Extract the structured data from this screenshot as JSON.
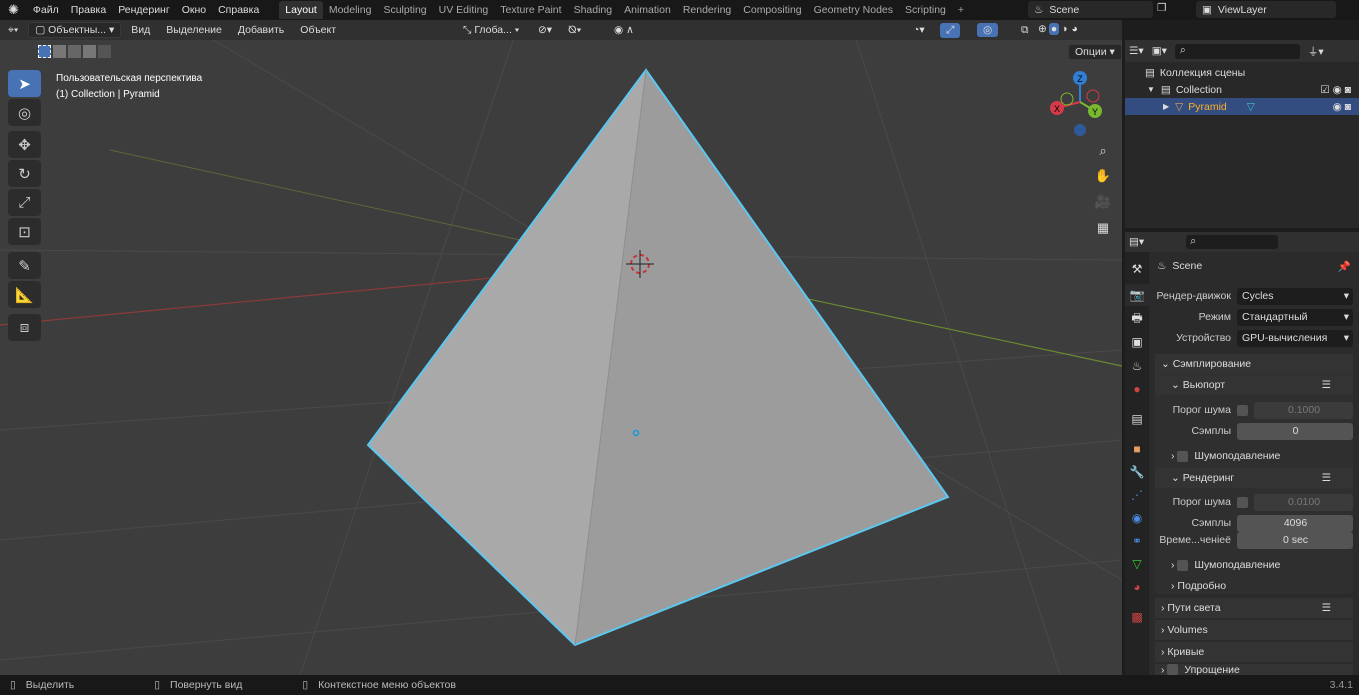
{
  "menu": {
    "items": [
      "Файл",
      "Правка",
      "Рендеринг",
      "Окно",
      "Справка"
    ]
  },
  "workspaces": [
    "Layout",
    "Modeling",
    "Sculpting",
    "UV Editing",
    "Texture Paint",
    "Shading",
    "Animation",
    "Rendering",
    "Compositing",
    "Geometry Nodes",
    "Scripting",
    "+"
  ],
  "scene": "Scene",
  "view_layer": "ViewLayer",
  "viewport": {
    "mode": "Объектны...",
    "menus": [
      "Вид",
      "Выделение",
      "Добавить",
      "Объект"
    ],
    "orientation": "Глоба...",
    "options": "Опции",
    "info_line1": "Пользовательская перспектива",
    "info_line2": "(1) Collection | Pyramid"
  },
  "outliner": {
    "root": "Коллекция сцены",
    "collection": "Collection",
    "object": "Pyramid"
  },
  "properties": {
    "title": "Scene",
    "engine_label": "Рендер-движок",
    "engine": "Cycles",
    "mode_label": "Режим",
    "mode": "Стандартный",
    "device_label": "Устройство",
    "device": "GPU-вычисления",
    "sampling": "Сэмплирование",
    "viewport_sub": "Вьюпорт",
    "noise_label": "Порог шума",
    "vp_noise": "0.1000",
    "samples_label": "Сэмплы",
    "vp_samples": "0",
    "denoise": "Шумоподавление",
    "render_sub": "Рендеринг",
    "r_noise": "0.0100",
    "r_samples": "4096",
    "time_label": "Време...ченieё",
    "time": "0 sec",
    "advanced": "Подробно",
    "light_paths": "Пути света",
    "volumes": "Volumes",
    "curves": "Кривые",
    "simplify": "Упрощение"
  },
  "status": {
    "select": "Выделить",
    "rotate": "Повернуть вид",
    "context": "Контекстное меню объектов",
    "version": "3.4.1"
  },
  "colors": {
    "accent": "#4772b3",
    "selection": "#4fc3f7"
  }
}
